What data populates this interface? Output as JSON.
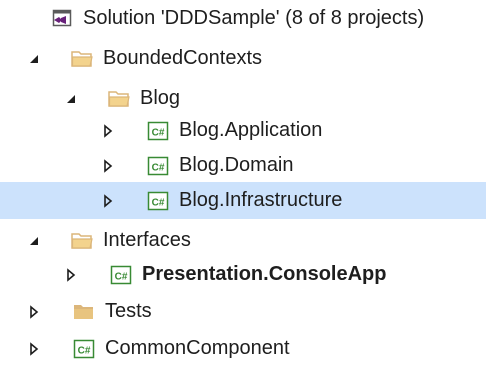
{
  "tree": {
    "solution": {
      "label": "Solution 'DDDSample' (8 of 8 projects)",
      "icon": "solution-icon"
    },
    "nodes": [
      {
        "label": "BoundedContexts",
        "icon": "folder-open-icon",
        "state": "expanded"
      },
      {
        "label": "Blog",
        "icon": "folder-open-icon",
        "state": "expanded"
      },
      {
        "label": "Blog.Application",
        "icon": "csharp-project-icon",
        "state": "collapsed"
      },
      {
        "label": "Blog.Domain",
        "icon": "csharp-project-icon",
        "state": "collapsed"
      },
      {
        "label": "Blog.Infrastructure",
        "icon": "csharp-project-icon",
        "state": "collapsed",
        "selected": true
      },
      {
        "label": "Interfaces",
        "icon": "folder-open-icon",
        "state": "expanded"
      },
      {
        "label": "Presentation.ConsoleApp",
        "icon": "csharp-project-icon",
        "state": "collapsed",
        "bold": true
      },
      {
        "label": "Tests",
        "icon": "folder-closed-icon",
        "state": "collapsed"
      },
      {
        "label": "CommonComponent",
        "icon": "csharp-project-icon",
        "state": "collapsed"
      }
    ],
    "project_icon_text": "C#"
  },
  "colors": {
    "selection": "#cce2fc",
    "folder": "#dcb67a",
    "csharp_project": "#388a34",
    "solution": "#68217a",
    "expander": "#1e1e1e",
    "text": "#1e1e1e"
  }
}
